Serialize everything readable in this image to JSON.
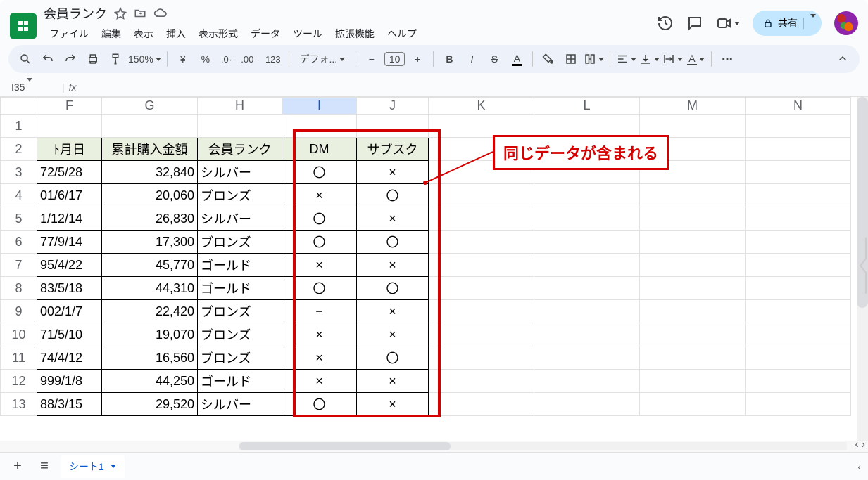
{
  "doc": {
    "title": "会員ランク"
  },
  "menu": {
    "file": "ファイル",
    "edit": "編集",
    "view": "表示",
    "insert": "挿入",
    "format": "表示形式",
    "data": "データ",
    "tools": "ツール",
    "extensions": "拡張機能",
    "help": "ヘルプ"
  },
  "share": {
    "label": "共有"
  },
  "toolbar": {
    "zoom": "150%",
    "yen": "¥",
    "pct": "%",
    "dec_dec": ".0",
    "dec_inc": ".00",
    "fmt123": "123",
    "font": "デフォ...",
    "fontsize": "10",
    "minus": "−",
    "plus": "+",
    "bold": "B",
    "italic": "I",
    "strike": "S",
    "color": "A"
  },
  "namebox": {
    "ref": "I35",
    "fx": "fx"
  },
  "cols": [
    "F",
    "G",
    "H",
    "I",
    "J",
    "K",
    "L",
    "M",
    "N"
  ],
  "rows": [
    "1",
    "2",
    "3",
    "4",
    "5",
    "6",
    "7",
    "8",
    "9",
    "10",
    "11",
    "12",
    "13"
  ],
  "selected_col": "I",
  "headers": {
    "f": "ﾄ月日",
    "g": "累計購入金額",
    "h": "会員ランク",
    "i": "DM",
    "j": "サブスク"
  },
  "data_rows": [
    {
      "f": "72/5/28",
      "g": "32,840",
      "h": "シルバー",
      "i": "〇",
      "j": "×"
    },
    {
      "f": "01/6/17",
      "g": "20,060",
      "h": "ブロンズ",
      "i": "×",
      "j": "〇"
    },
    {
      "f": "1/12/14",
      "g": "26,830",
      "h": "シルバー",
      "i": "〇",
      "j": "×"
    },
    {
      "f": "77/9/14",
      "g": "17,300",
      "h": "ブロンズ",
      "i": "〇",
      "j": "〇"
    },
    {
      "f": "95/4/22",
      "g": "45,770",
      "h": "ゴールド",
      "i": "×",
      "j": "×"
    },
    {
      "f": "83/5/18",
      "g": "44,310",
      "h": "ゴールド",
      "i": "〇",
      "j": "〇"
    },
    {
      "f": "002/1/7",
      "g": "22,420",
      "h": "ブロンズ",
      "i": "−",
      "j": "×"
    },
    {
      "f": "71/5/10",
      "g": "19,070",
      "h": "ブロンズ",
      "i": "×",
      "j": "×"
    },
    {
      "f": "74/4/12",
      "g": "16,560",
      "h": "ブロンズ",
      "i": "×",
      "j": "〇"
    },
    {
      "f": "999/1/8",
      "g": "44,250",
      "h": "ゴールド",
      "i": "×",
      "j": "×"
    },
    {
      "f": "88/3/15",
      "g": "29,520",
      "h": "シルバー",
      "i": "〇",
      "j": "×"
    }
  ],
  "annotation": {
    "text": "同じデータが含まれる"
  },
  "sheettab": {
    "name": "シート1"
  }
}
